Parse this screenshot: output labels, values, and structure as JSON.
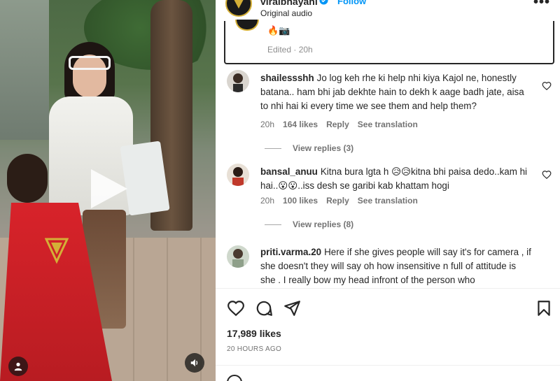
{
  "header": {
    "username": "viralbhayani",
    "follow_label": "Follow",
    "audio_label": "Original audio",
    "more_label": "•••"
  },
  "caption": {
    "emoji": "🔥📷",
    "edited": "Edited · 20h"
  },
  "comments": [
    {
      "username": "shailessshh",
      "text": "Jo log keh rhe ki help nhi kiya Kajol ne, honestly batana.. ham bhi jab dekhte hain to dekh k aage badh jate, aisa to nhi hai ki every time we see them and help them?",
      "time": "20h",
      "likes": "164 likes",
      "reply": "Reply",
      "translate": "See translation",
      "view_replies": "View replies (3)"
    },
    {
      "username": "bansal_anuu",
      "text": "Kitna bura lgta h 😥😥kitna bhi paisa dedo..kam hi hai..😮😮..iss desh se garibi kab khattam hogi",
      "time": "20h",
      "likes": "100 likes",
      "reply": "Reply",
      "translate": "See translation",
      "view_replies": "View replies (8)"
    },
    {
      "username": "priti.varma.20",
      "text": "Here if she gives people will say it's for camera , if she doesn't they will say oh how insensitive n full of attitude is she . I really bow my head infront of the person who"
    }
  ],
  "post": {
    "likes": "17,989 likes",
    "time": "20 HOURS AGO"
  },
  "colors": {
    "accent": "#0095f6",
    "muted": "#737373",
    "text": "#262626"
  }
}
